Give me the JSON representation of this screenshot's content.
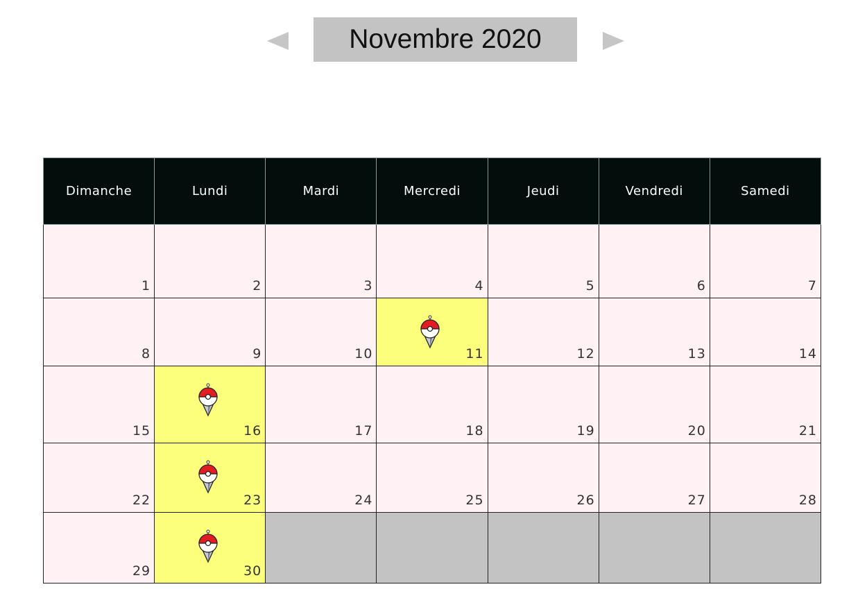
{
  "calendar": {
    "month_label": "Novembre 2020",
    "prev_icon": "triangle-left-icon",
    "next_icon": "triangle-right-icon",
    "weekdays": [
      "Dimanche",
      "Lundi",
      "Mardi",
      "Mercredi",
      "Jeudi",
      "Vendredi",
      "Samedi"
    ],
    "weeks": [
      [
        "1",
        "2",
        "3",
        "4",
        "5",
        "6",
        "7"
      ],
      [
        "8",
        "9",
        "10",
        "11",
        "12",
        "13",
        "14"
      ],
      [
        "15",
        "16",
        "17",
        "18",
        "19",
        "20",
        "21"
      ],
      [
        "22",
        "23",
        "24",
        "25",
        "26",
        "27",
        "28"
      ],
      [
        "29",
        "30",
        "",
        "",
        "",
        "",
        ""
      ]
    ],
    "event_days": [
      "11",
      "16",
      "23",
      "30"
    ],
    "event_icon": "pokeball-pin-icon"
  },
  "colors": {
    "header_bg": "#030d0b",
    "day_bg": "#fff1f4",
    "event_bg": "#fbff7b",
    "empty_bg": "#c3c3c3",
    "title_bg": "#c3c3c3"
  }
}
